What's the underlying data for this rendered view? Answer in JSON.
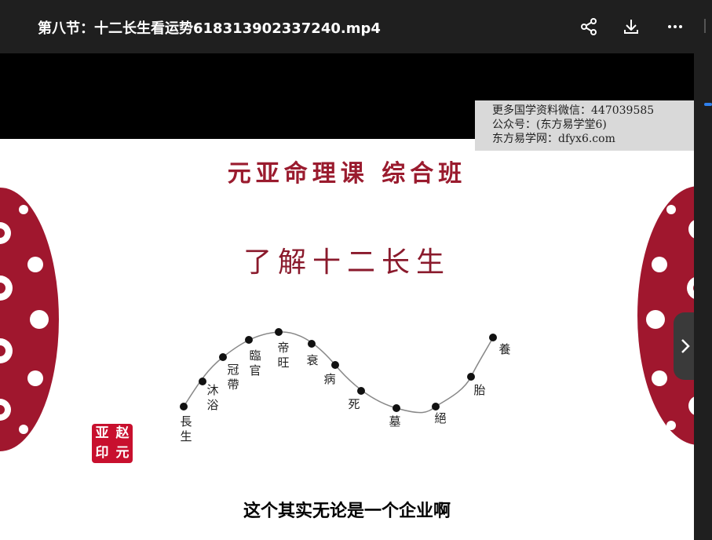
{
  "window": {
    "title": "第八节：十二长生看运势618313902337240.mp4",
    "share_icon": "share-icon",
    "download_icon": "download-icon",
    "more_icon": "more-dots-icon"
  },
  "video": {
    "watermark": [
      "更多国学资料微信：447039585",
      "公众号：(东方易学堂6)",
      "东方易学网：dfyx6.com"
    ],
    "course_title": "元亚命理课 综合班",
    "slide_heading": "了解十二长生",
    "stages": [
      "長生",
      "沐浴",
      "冠帶",
      "臨官",
      "帝旺",
      "衰",
      "病",
      "死",
      "墓",
      "絕",
      "胎",
      "養"
    ],
    "seal_text": [
      "亚",
      "赵",
      "印",
      "元"
    ],
    "subtitle": "这个其实无论是一个企业啊",
    "next_icon": "chevron-right-icon",
    "accent_color": "#8a1a2c",
    "seal_color": "#c8102e"
  }
}
